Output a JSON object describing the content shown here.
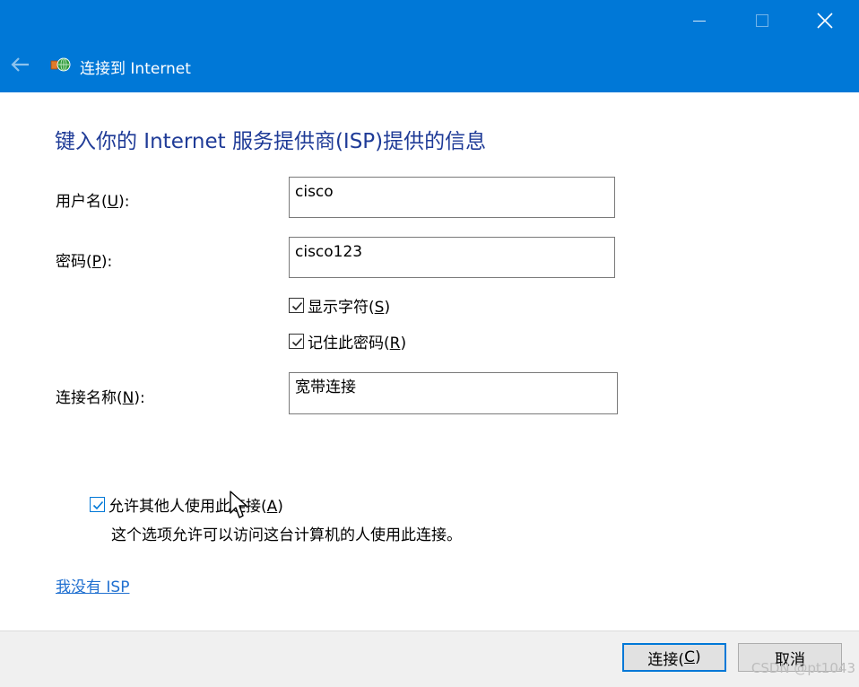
{
  "window": {
    "title": "连接到 Internet",
    "controls": {
      "minimize_icon": "minimize-icon",
      "maximize_icon": "maximize-icon",
      "close_icon": "close-icon"
    },
    "accent_color": "#0078d7"
  },
  "heading": "键入你的 Internet 服务提供商(ISP)提供的信息",
  "form": {
    "username": {
      "label_text": "用户名(",
      "label_key": "U",
      "label_end": "):",
      "value": "cisco"
    },
    "password": {
      "label_text": "密码(",
      "label_key": "P",
      "label_end": "):",
      "value": "cisco123"
    },
    "show_chars": {
      "label_text": "显示字符(",
      "label_key": "S",
      "label_end": ")",
      "checked": true
    },
    "remember": {
      "label_text": "记住此密码(",
      "label_key": "R",
      "label_end": ")",
      "checked": true
    },
    "connection_name": {
      "label_text": "连接名称(",
      "label_key": "N",
      "label_end": "):",
      "value": "宽带连接"
    }
  },
  "allow_others": {
    "label_text": "允许其他人使用此连接(",
    "label_key": "A",
    "label_end": ")",
    "checked": true,
    "description": "这个选项允许可以访问这台计算机的人使用此连接。"
  },
  "no_isp_link": "我没有 ISP",
  "buttons": {
    "connect": {
      "label_text": "连接(",
      "label_key": "C",
      "label_end": ")"
    },
    "cancel": "取消"
  },
  "watermark": "CSDN @pt1043"
}
